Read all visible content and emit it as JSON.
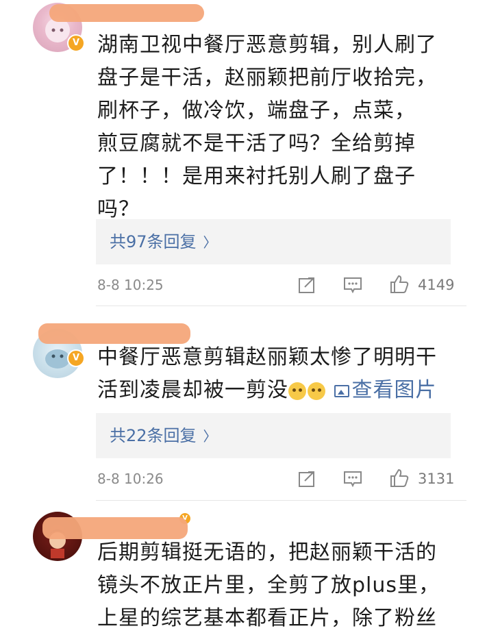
{
  "comments": [
    {
      "lines": [
        "湖南卫视中餐厅恶意剪辑，别人刷了",
        "盘子是干活，赵丽颖把前厅收拾完，",
        "刷杯子，做冷饮，端盘子，点菜，",
        "煎豆腐就不是干活了吗？全给剪掉",
        "了！！！是用来衬托别人刷了盘子",
        "吗？"
      ],
      "replies": "共97条回复",
      "time": "8-8 10:25",
      "likes": "4149"
    },
    {
      "line1": "中餐厅恶意剪辑赵丽颖太惨了明明干",
      "line2": "活到凌晨却被一剪没",
      "view_image": "查看图片",
      "replies": "共22条回复",
      "time": "8-8 10:26",
      "likes": "3131"
    },
    {
      "lines": [
        "后期剪辑挺无语的，把赵丽颖干活的",
        "镜头不放正片里，全剪了放plus里，",
        "上星的综艺基本都看正片，除了粉丝"
      ]
    }
  ],
  "icons": {
    "reply_chevron": "chevron-right-icon",
    "share": "share-icon",
    "comment": "comment-icon",
    "like": "thumbs-up-icon",
    "verified": "verified-badge-icon"
  },
  "colors": {
    "link": "#4a6fa5",
    "badge": "#f5a623",
    "redaction": "#f4a77a"
  }
}
